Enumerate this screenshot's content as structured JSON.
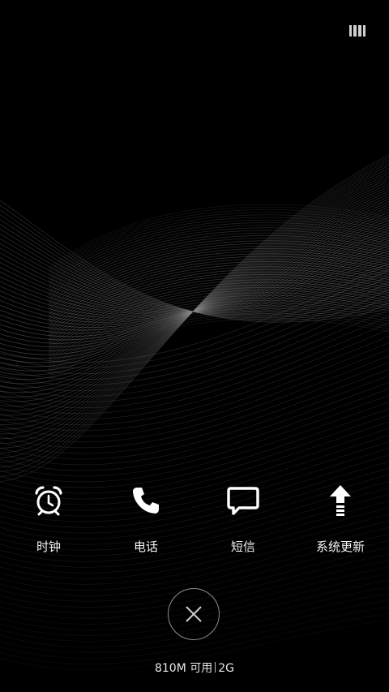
{
  "top_toggle": {
    "icon": "recents-grid-icon"
  },
  "apps": [
    {
      "label": "时钟",
      "icon": "alarm-clock-icon"
    },
    {
      "label": "电话",
      "icon": "phone-icon"
    },
    {
      "label": "短信",
      "icon": "message-icon"
    },
    {
      "label": "系统更新",
      "icon": "update-arrow-icon"
    }
  ],
  "close_button": {
    "icon": "close-icon"
  },
  "memory": {
    "available": "810M 可用",
    "total": "2G"
  },
  "colors": {
    "background": "#000000",
    "text": "#ffffff"
  }
}
